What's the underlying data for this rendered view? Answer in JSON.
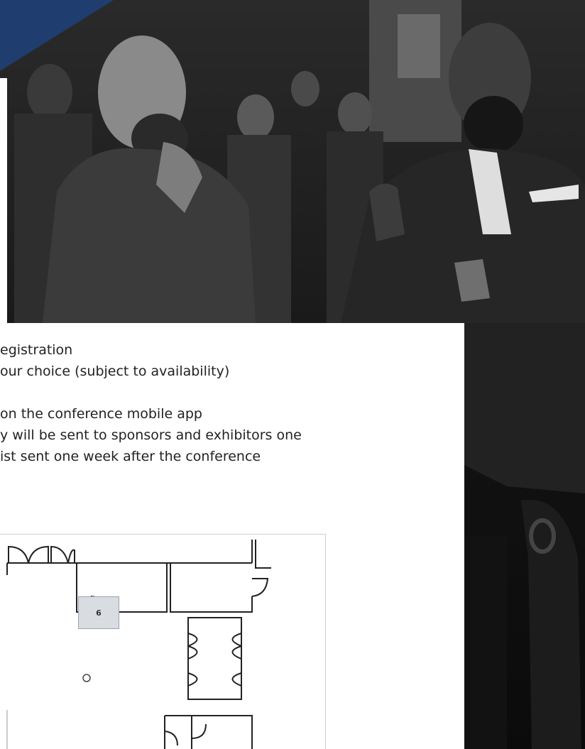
{
  "photo": {
    "description_icon": "people-networking-photo"
  },
  "bullets": [
    "egistration",
    "our choice (subject to availability)",
    "",
    "on the conference mobile app",
    "y will be sent to sponsors and exhibitors one",
    "ist sent one week after the conference"
  ],
  "floorplan": {
    "booth_label": "6"
  },
  "colors": {
    "accent": "#1f3d6e",
    "booth_fill": "#d9dde2"
  }
}
